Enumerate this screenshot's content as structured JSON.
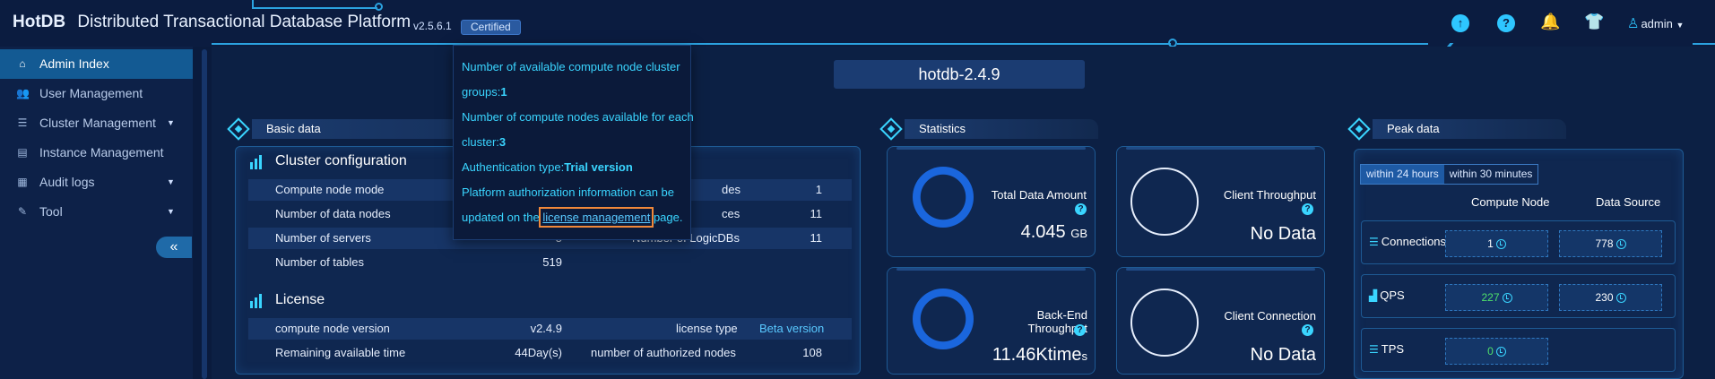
{
  "header": {
    "logo": "HotDB",
    "title": "Distributed Transactional Database Platform",
    "version": "v2.5.6.1",
    "badge": "Certified",
    "user": "admin",
    "icons": [
      "upload-icon",
      "help-icon",
      "bell-icon",
      "shirt-icon",
      "user-icon"
    ]
  },
  "sidebar": {
    "items": [
      {
        "label": "Admin Index",
        "icon": "home-icon",
        "active": true
      },
      {
        "label": "User Management",
        "icon": "users-icon"
      },
      {
        "label": "Cluster Management",
        "icon": "database-icon",
        "expandable": true
      },
      {
        "label": "Instance Management",
        "icon": "server-icon"
      },
      {
        "label": "Audit logs",
        "icon": "log-icon",
        "expandable": true
      },
      {
        "label": "Tool",
        "icon": "wrench-icon",
        "expandable": true
      }
    ],
    "collapse": "«"
  },
  "cluster_tab": "hotdb-2.4.9",
  "basic": {
    "title": "Basic data",
    "config_title": "Cluster configuration",
    "rows": [
      {
        "label": "Compute node mode",
        "value": "",
        "label2": "des",
        "value2": "1"
      },
      {
        "label": "Number of data nodes",
        "value": "",
        "label2": "ces",
        "value2": "11"
      },
      {
        "label": "Number of servers",
        "value": "5",
        "label2": "Number of LogicDBs",
        "value2": "11"
      },
      {
        "label": "Number of tables",
        "value": "519",
        "label2": "",
        "value2": ""
      }
    ],
    "license_title": "License",
    "license_rows": [
      {
        "label": "compute node version",
        "value": "v2.4.9",
        "label2": "license type",
        "value2": "Beta version"
      },
      {
        "label": "Remaining available time",
        "value": "44Day(s)",
        "label2": "number of authorized nodes",
        "value2": "108"
      }
    ]
  },
  "statistics": {
    "title": "Statistics",
    "cards": [
      {
        "label": "Total Data Amount",
        "value": "4.045",
        "unit": "GB"
      },
      {
        "label": "Client Throughput",
        "value": "No Data",
        "unit": ""
      },
      {
        "label": "Back-End Throughput",
        "value": "11.46Ktime",
        "unit": "s"
      },
      {
        "label": "Client Connection",
        "value": "No Data",
        "unit": ""
      }
    ],
    "help": "?"
  },
  "peak": {
    "title": "Peak data",
    "tabs": [
      "within 24 hours",
      "within 30 minutes"
    ],
    "col1": "Compute Node",
    "col2": "Data Source",
    "rows": [
      {
        "label": "Connections",
        "v1": "1",
        "v2": "778"
      },
      {
        "label": "QPS",
        "v1": "227",
        "v2": "230"
      },
      {
        "label": "TPS",
        "v1": "0",
        "v2": ""
      }
    ]
  },
  "tooltip": {
    "line1a": "Number of available compute node cluster",
    "line1b": "groups:",
    "line1v": "1",
    "line2a": "Number of compute nodes available for each",
    "line2b": "cluster:",
    "line2v": "3",
    "line3a": "Authentication type:",
    "line3v": "Trial version",
    "line4": "Platform authorization information can be",
    "line5a": "updated on the ",
    "link": "license management",
    "line5b": " page."
  },
  "colors": {
    "accent": "#3ad5ff",
    "active_nav": "#135a93",
    "donut": "#1a66dd",
    "highlight_box": "#f0883a",
    "positive": "#4fe06a"
  }
}
